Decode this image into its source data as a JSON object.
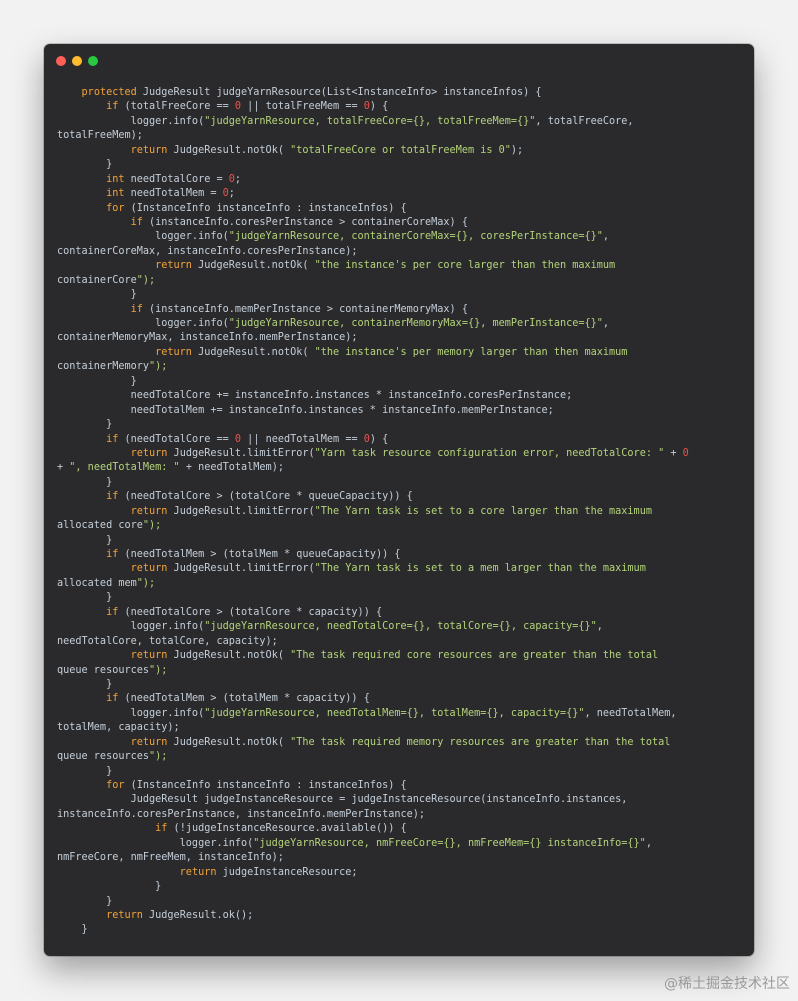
{
  "window": {
    "controls": [
      {
        "name": "close",
        "color": "#ff5f57"
      },
      {
        "name": "minimize",
        "color": "#febc2e"
      },
      {
        "name": "zoom",
        "color": "#28c840"
      }
    ]
  },
  "code": {
    "language": "java",
    "lines": [
      "    protected JudgeResult judgeYarnResource(List<InstanceInfo> instanceInfos) {",
      "        if (totalFreeCore == 0 || totalFreeMem == 0) {",
      "            logger.info(\"judgeYarnResource, totalFreeCore={}, totalFreeMem={}\", totalFreeCore,",
      "totalFreeMem);",
      "            return JudgeResult.notOk( \"totalFreeCore or totalFreeMem is 0\");",
      "        }",
      "        int needTotalCore = 0;",
      "        int needTotalMem = 0;",
      "        for (InstanceInfo instanceInfo : instanceInfos) {",
      "            if (instanceInfo.coresPerInstance > containerCoreMax) {",
      "                logger.info(\"judgeYarnResource, containerCoreMax={}, coresPerInstance={}\",",
      "containerCoreMax, instanceInfo.coresPerInstance);",
      "                return JudgeResult.notOk( \"the instance's per core larger than then maximum",
      "containerCore\");",
      "            }",
      "            if (instanceInfo.memPerInstance > containerMemoryMax) {",
      "                logger.info(\"judgeYarnResource, containerMemoryMax={}, memPerInstance={}\",",
      "containerMemoryMax, instanceInfo.memPerInstance);",
      "                return JudgeResult.notOk( \"the instance's per memory larger than then maximum",
      "containerMemory\");",
      "            }",
      "            needTotalCore += instanceInfo.instances * instanceInfo.coresPerInstance;",
      "            needTotalMem += instanceInfo.instances * instanceInfo.memPerInstance;",
      "        }",
      "        if (needTotalCore == 0 || needTotalMem == 0) {",
      "            return JudgeResult.limitError(\"Yarn task resource configuration error, needTotalCore: \" + 0",
      "+ \", needTotalMem: \" + needTotalMem);",
      "        }",
      "        if (needTotalCore > (totalCore * queueCapacity)) {",
      "            return JudgeResult.limitError(\"The Yarn task is set to a core larger than the maximum",
      "allocated core\");",
      "        }",
      "        if (needTotalMem > (totalMem * queueCapacity)) {",
      "            return JudgeResult.limitError(\"The Yarn task is set to a mem larger than the maximum",
      "allocated mem\");",
      "        }",
      "        if (needTotalCore > (totalCore * capacity)) {",
      "            logger.info(\"judgeYarnResource, needTotalCore={}, totalCore={}, capacity={}\",",
      "needTotalCore, totalCore, capacity);",
      "            return JudgeResult.notOk( \"The task required core resources are greater than the total",
      "queue resources\");",
      "        }",
      "        if (needTotalMem > (totalMem * capacity)) {",
      "            logger.info(\"judgeYarnResource, needTotalMem={}, totalMem={}, capacity={}\", needTotalMem,",
      "totalMem, capacity);",
      "            return JudgeResult.notOk( \"The task required memory resources are greater than the total",
      "queue resources\");",
      "        }",
      "        for (InstanceInfo instanceInfo : instanceInfos) {",
      "            JudgeResult judgeInstanceResource = judgeInstanceResource(instanceInfo.instances,",
      "instanceInfo.coresPerInstance, instanceInfo.memPerInstance);",
      "                if (!judgeInstanceResource.available()) {",
      "                    logger.info(\"judgeYarnResource, nmFreeCore={}, nmFreeMem={} instanceInfo={}\",",
      "nmFreeCore, nmFreeMem, instanceInfo);",
      "                    return judgeInstanceResource;",
      "                }",
      "        }",
      "        return JudgeResult.ok();",
      "    }"
    ]
  },
  "watermark": "@稀土掘金技术社区",
  "colors": {
    "background": "#f2f2f2",
    "window": "#2a2a2c",
    "text": "#c4ced9",
    "keyword": "#f2a33a",
    "number": "#e8534b",
    "string": "#b4d47a"
  }
}
